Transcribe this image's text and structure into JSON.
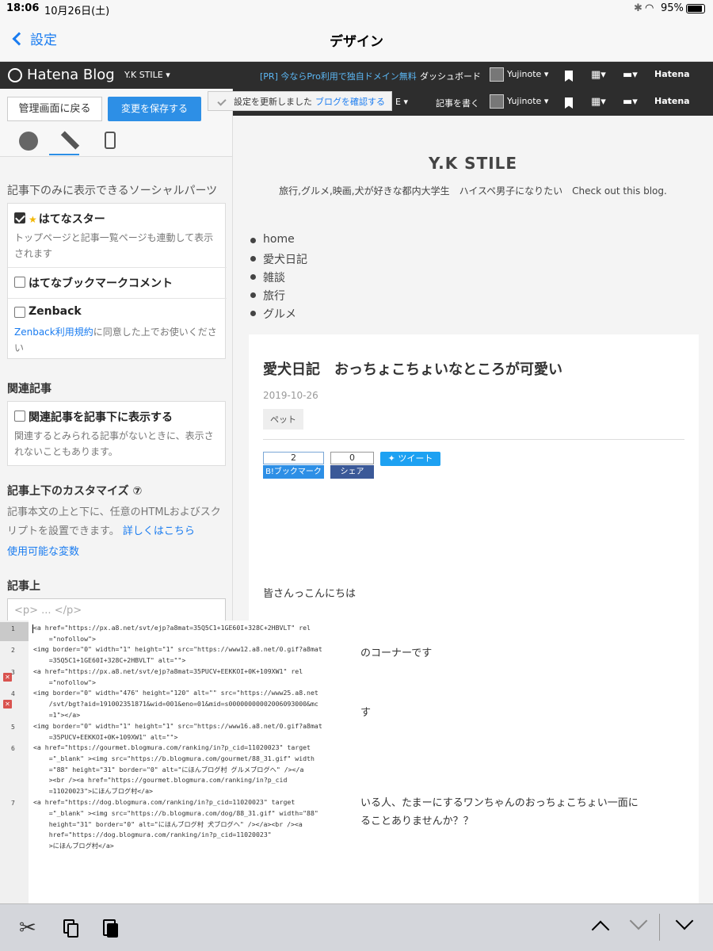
{
  "status": {
    "time": "18:06",
    "date": "10月26日(土)",
    "battery": "95%"
  },
  "nav": {
    "back_label": "設定",
    "title": "デザイン"
  },
  "hatena_bar": {
    "logo": "Hatena Blog",
    "blog_name": "Y.K STILE ▾",
    "promo": "[PR] 今ならPro利用で独自ドメイン無料",
    "dashboard": "ダッシュボード",
    "user": "Yujinote ▾",
    "brand": "Hatena",
    "write": "記事を書く",
    "blog_menu": "E ▾"
  },
  "toast": {
    "message": "設定を更新しました",
    "link": "ブログを確認する"
  },
  "panel": {
    "back_button": "管理画面に戻る",
    "save_button": "変更を保存する",
    "social_heading": "記事下のみに表示できるソーシャルパーツ",
    "star": {
      "label": "はてなスター",
      "desc": "トップページと記事一覧ページも連動して表示されます",
      "checked": true
    },
    "bookmark_comment": {
      "label": "はてなブックマークコメント",
      "checked": false
    },
    "zenback": {
      "label": "Zenback",
      "link": "Zenback利用規約",
      "desc": "に同意した上でお使いください",
      "checked": false
    },
    "related_heading": "関連記事",
    "related": {
      "label": "関連記事を記事下に表示する",
      "desc": "関連するとみられる記事がないときに、表示されないこともあります。",
      "checked": false
    },
    "customize_heading": "記事上下のカスタマイズ ⑦",
    "customize_desc": "記事本文の上と下に、任意のHTMLおよびスクリプトを設置できます。",
    "customize_link": "詳しくはこちら",
    "variables_link": "使用可能な変数",
    "above_heading": "記事上",
    "textarea_placeholder": "<p> ... </p>"
  },
  "preview": {
    "blog_title": "Y.K STILE",
    "tagline": "旅行,グルメ,映画,犬が好きな都内大学生　ハイスペ男子になりたい　Check out this blog.",
    "nav": [
      "home",
      "愛犬日記",
      "雑談",
      "旅行",
      "グルメ"
    ],
    "article_title": "愛犬日記　おっちょこちょいなところが可愛い",
    "date": "2019-10-26",
    "category": "ペット",
    "bookmark_count": "2",
    "bookmark_btn": "B!ブックマーク",
    "fb_count": "0",
    "fb_btn": "シェア",
    "tweet_btn": "ツイート",
    "p1": "皆さんっこんにちは",
    "p2": "のコーナーです",
    "p3": "す",
    "p4": "いる人、たまーにするワンちゃんのおっちょこちょい一面に",
    "p5": "ることありませんか？？"
  },
  "editor": {
    "line_numbers": [
      "1",
      "2",
      "3",
      "4",
      "5",
      "6",
      "7"
    ],
    "lines": [
      "<a href=\"https://px.a8.net/svt/ejp?a8mat=35Q5C1+1GE60I+328C+2HBVLT\" rel\n    =\"nofollow\">",
      "<img border=\"0\" width=\"1\" height=\"1\" src=\"https://www12.a8.net/0.gif?a8mat\n    =35Q5C1+1GE60I+328C+2HBVLT\" alt=\"\">",
      "<a href=\"https://px.a8.net/svt/ejp?a8mat=35PUCV+EEKKOI+0K+109XW1\" rel\n    =\"nofollow\">",
      "<img border=\"0\" width=\"476\" height=\"120\" alt=\"\" src=\"https://www25.a8.net\n    /svt/bgt?aid=191002351871&wid=001&eno=01&mid=s00000000002006093000&mc\n    =1\"></a>",
      "<img border=\"0\" width=\"1\" height=\"1\" src=\"https://www16.a8.net/0.gif?a8mat\n    =35PUCV+EEKKOI+0K+109XW1\" alt=\"\">",
      "<a href=\"https://gourmet.blogmura.com/ranking/in?p_cid=11020023\" target\n    =\"_blank\" ><img src=\"https://b.blogmura.com/gourmet/88_31.gif\" width\n    =\"88\" height=\"31\" border=\"0\" alt=\"にほんブログ村 グルメブログへ\" /></a\n    ><br /><a href=\"https://gourmet.blogmura.com/ranking/in?p_cid\n    =11020023\">にほんブログ村</a>",
      "<a href=\"https://dog.blogmura.com/ranking/in?p_cid=11020023\" target\n    =\"_blank\" ><img src=\"https://b.blogmura.com/dog/88_31.gif\" width=\"88\"\n    height=\"31\" border=\"0\" alt=\"にほんブログ村 犬ブログへ\" /></a><br /><a\n    href=\"https://dog.blogmura.com/ranking/in?p_cid=11020023\"\n    >にほんブログ村</a>"
    ]
  },
  "toolbar": {
    "icons": [
      "scissors-icon",
      "copy-icon",
      "paste-icon",
      "chevron-up-icon",
      "chevron-down-icon",
      "keyboard-dismiss-icon"
    ]
  }
}
